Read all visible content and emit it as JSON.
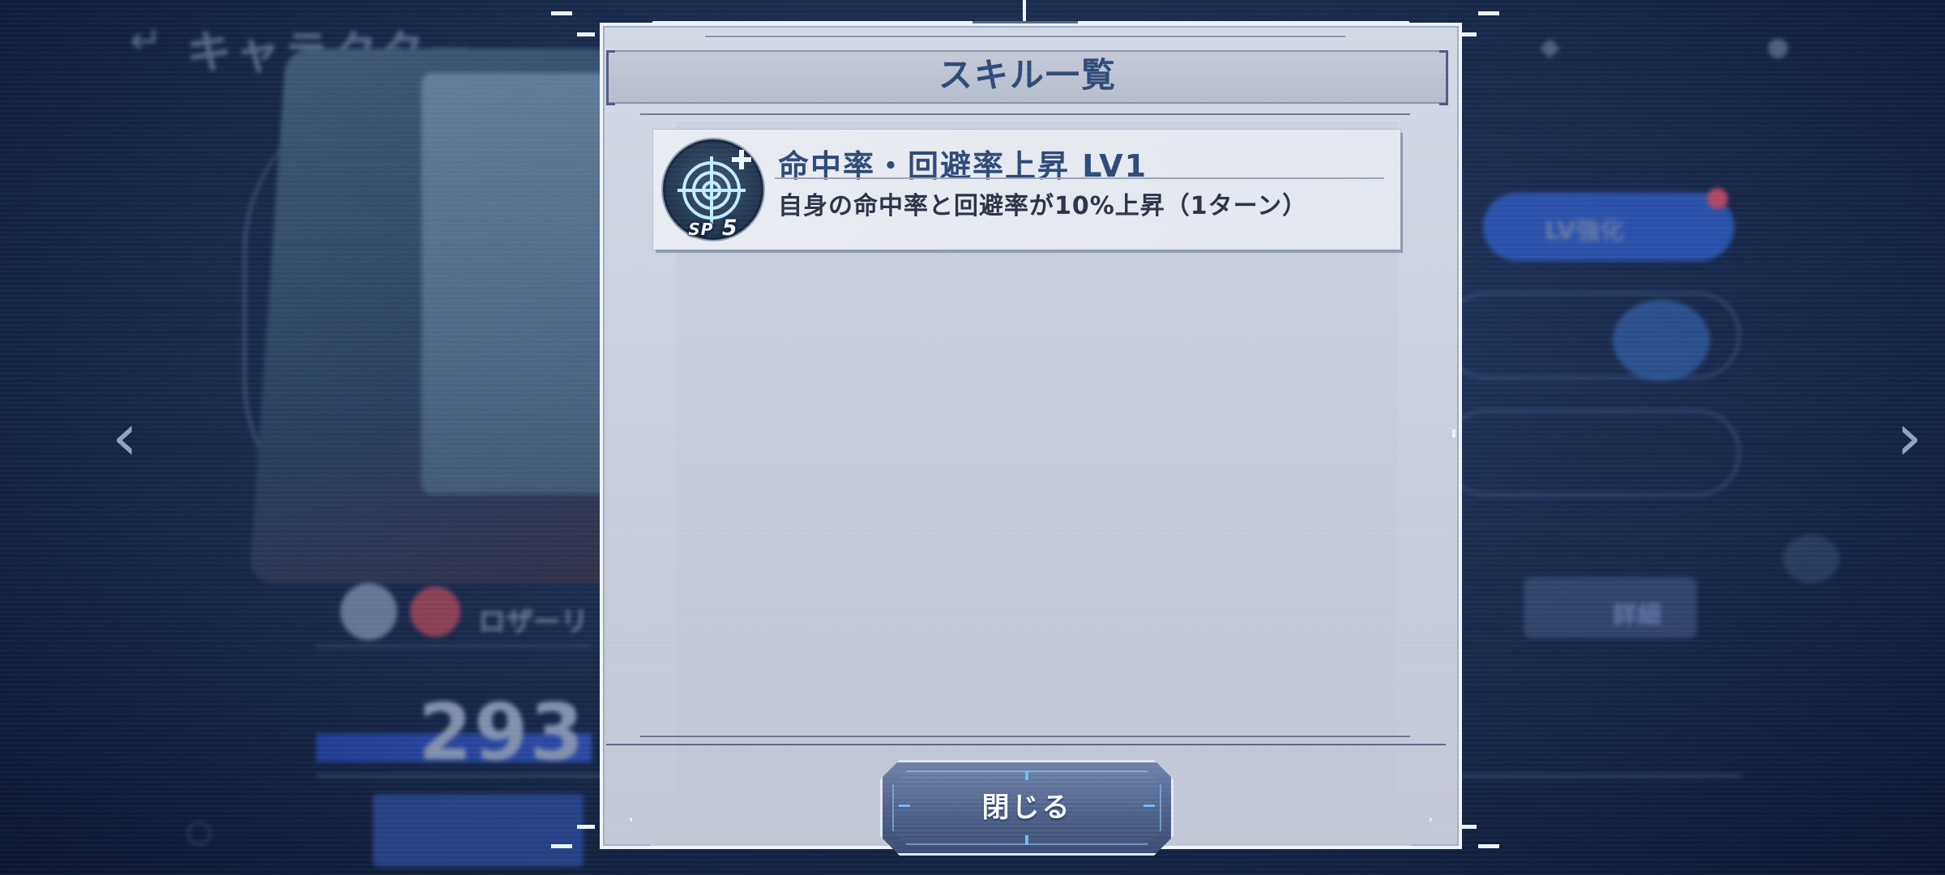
{
  "background": {
    "screen_title": "キャラクター",
    "character_name": "ロザーリ",
    "power_value": "293",
    "lv_button": "LV強化",
    "detail_button": "詳細",
    "nav_left": "‹",
    "nav_right": "›"
  },
  "modal": {
    "title": "スキル一覧",
    "skills": [
      {
        "name": "命中率・回避率上昇 LV1",
        "description": "自身の命中率と回避率が10%上昇（1ターン）",
        "sp_label": "SP",
        "sp_cost": "5",
        "icon": "crosshair-plus-icon"
      }
    ],
    "close_label": "閉じる"
  },
  "colors": {
    "accent": "#2f4a78",
    "modal_bg": "#c6ccda",
    "button": "#4c5f89",
    "glow": "#aac8ff"
  }
}
